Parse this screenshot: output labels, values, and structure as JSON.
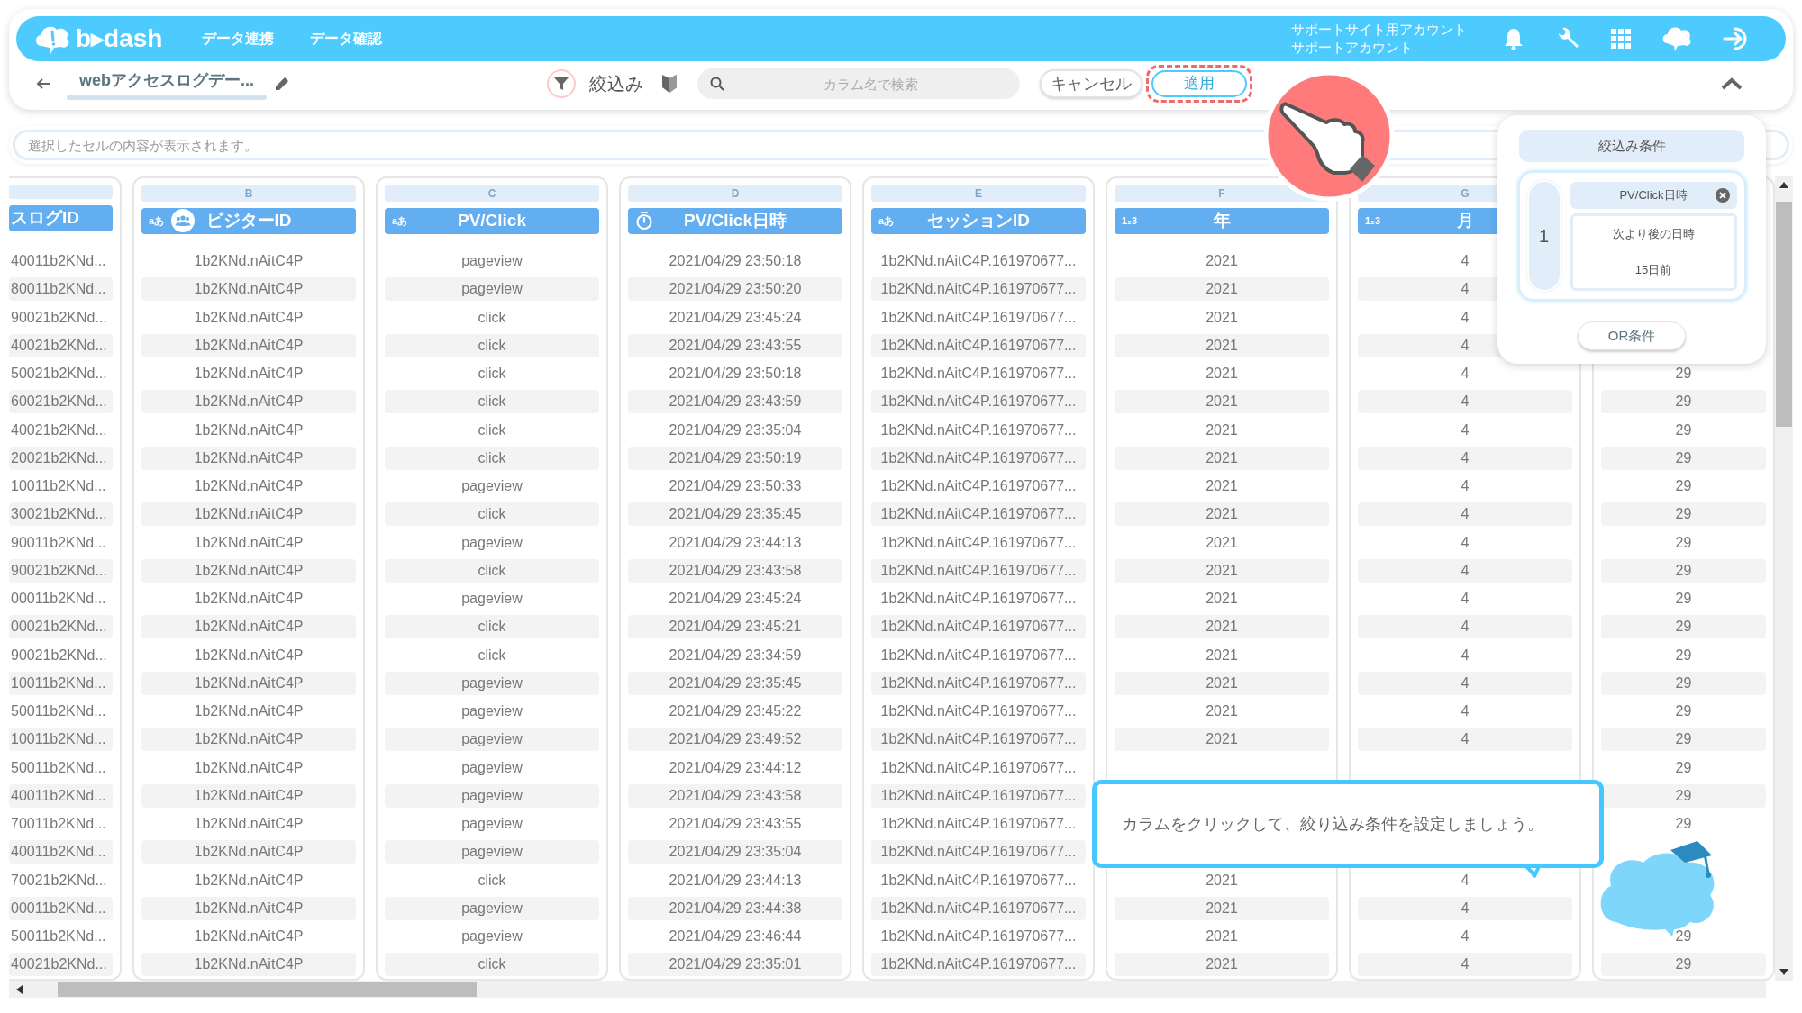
{
  "header": {
    "logo": "b▸dash",
    "nav": [
      "データ連携",
      "データ確認"
    ],
    "account": [
      "サポートサイト用アカウント",
      "サポートアカウント"
    ]
  },
  "toolbar": {
    "title": "webアクセスログデー...",
    "filter_active": true,
    "filter_label": "絞込み",
    "search_placeholder": "カラム名で検索",
    "cancel": "キャンセル",
    "apply": "適用",
    "apply_highlighted": true
  },
  "cell_field": {
    "placeholder": "選択したセルの内容が表示されます。"
  },
  "columns": [
    {
      "title": "スログID"
    },
    {
      "letter": "B",
      "type_label": "aあ",
      "kind": "people",
      "title": "ビジターID"
    },
    {
      "letter": "C",
      "type_label": "aあ",
      "title": "PV/Click"
    },
    {
      "letter": "D",
      "kind": "timer",
      "title": "PV/Click日時"
    },
    {
      "letter": "E",
      "type_label": "aあ",
      "title": "セッションID"
    },
    {
      "letter": "F",
      "type_label": "1₂3",
      "title": "年"
    },
    {
      "letter": "G",
      "type_label": "1₂3",
      "title": "月"
    }
  ],
  "rows": [
    [
      "40011b2KNd...",
      "1b2KNd.nAitC4P",
      "pageview",
      "2021/04/29 23:50:18",
      "1b2KNd.nAitC4P.161970677...",
      "2021",
      "4",
      null
    ],
    [
      "80011b2KNd...",
      "1b2KNd.nAitC4P",
      "pageview",
      "2021/04/29 23:50:20",
      "1b2KNd.nAitC4P.161970677...",
      "2021",
      "4",
      null
    ],
    [
      "90021b2KNd...",
      "1b2KNd.nAitC4P",
      "click",
      "2021/04/29 23:45:24",
      "1b2KNd.nAitC4P.161970677...",
      "2021",
      "4",
      null
    ],
    [
      "40021b2KNd...",
      "1b2KNd.nAitC4P",
      "click",
      "2021/04/29 23:43:55",
      "1b2KNd.nAitC4P.161970677...",
      "2021",
      "4",
      null
    ],
    [
      "50021b2KNd...",
      "1b2KNd.nAitC4P",
      "click",
      "2021/04/29 23:50:18",
      "1b2KNd.nAitC4P.161970677...",
      "2021",
      "4",
      "29"
    ],
    [
      "60021b2KNd...",
      "1b2KNd.nAitC4P",
      "click",
      "2021/04/29 23:43:59",
      "1b2KNd.nAitC4P.161970677...",
      "2021",
      "4",
      "29"
    ],
    [
      "40021b2KNd...",
      "1b2KNd.nAitC4P",
      "click",
      "2021/04/29 23:35:04",
      "1b2KNd.nAitC4P.161970677...",
      "2021",
      "4",
      "29"
    ],
    [
      "20021b2KNd...",
      "1b2KNd.nAitC4P",
      "click",
      "2021/04/29 23:50:19",
      "1b2KNd.nAitC4P.161970677...",
      "2021",
      "4",
      "29"
    ],
    [
      "10011b2KNd...",
      "1b2KNd.nAitC4P",
      "pageview",
      "2021/04/29 23:50:33",
      "1b2KNd.nAitC4P.161970677...",
      "2021",
      "4",
      "29"
    ],
    [
      "30021b2KNd...",
      "1b2KNd.nAitC4P",
      "click",
      "2021/04/29 23:35:45",
      "1b2KNd.nAitC4P.161970677...",
      "2021",
      "4",
      "29"
    ],
    [
      "90011b2KNd...",
      "1b2KNd.nAitC4P",
      "pageview",
      "2021/04/29 23:44:13",
      "1b2KNd.nAitC4P.161970677...",
      "2021",
      "4",
      "29"
    ],
    [
      "90021b2KNd...",
      "1b2KNd.nAitC4P",
      "click",
      "2021/04/29 23:43:58",
      "1b2KNd.nAitC4P.161970677...",
      "2021",
      "4",
      "29"
    ],
    [
      "00011b2KNd...",
      "1b2KNd.nAitC4P",
      "pageview",
      "2021/04/29 23:45:24",
      "1b2KNd.nAitC4P.161970677...",
      "2021",
      "4",
      "29"
    ],
    [
      "00021b2KNd...",
      "1b2KNd.nAitC4P",
      "click",
      "2021/04/29 23:45:21",
      "1b2KNd.nAitC4P.161970677...",
      "2021",
      "4",
      "29"
    ],
    [
      "90021b2KNd...",
      "1b2KNd.nAitC4P",
      "click",
      "2021/04/29 23:34:59",
      "1b2KNd.nAitC4P.161970677...",
      "2021",
      "4",
      "29"
    ],
    [
      "10011b2KNd...",
      "1b2KNd.nAitC4P",
      "pageview",
      "2021/04/29 23:35:45",
      "1b2KNd.nAitC4P.161970677...",
      "2021",
      "4",
      "29"
    ],
    [
      "50011b2KNd...",
      "1b2KNd.nAitC4P",
      "pageview",
      "2021/04/29 23:45:22",
      "1b2KNd.nAitC4P.161970677...",
      "2021",
      "4",
      "29"
    ],
    [
      "10011b2KNd...",
      "1b2KNd.nAitC4P",
      "pageview",
      "2021/04/29 23:49:52",
      "1b2KNd.nAitC4P.161970677...",
      "2021",
      "4",
      "29"
    ],
    [
      "50011b2KNd...",
      "1b2KNd.nAitC4P",
      "pageview",
      "2021/04/29 23:44:12",
      "1b2KNd.nAitC4P.161970677...",
      null,
      null,
      "29"
    ],
    [
      "40011b2KNd...",
      "1b2KNd.nAitC4P",
      "pageview",
      "2021/04/29 23:43:58",
      "1b2KNd.nAitC4P.161970677...",
      null,
      null,
      "29"
    ],
    [
      "70011b2KNd...",
      "1b2KNd.nAitC4P",
      "pageview",
      "2021/04/29 23:43:55",
      "1b2KNd.nAitC4P.161970677...",
      null,
      null,
      "29"
    ],
    [
      "40011b2KNd...",
      "1b2KNd.nAitC4P",
      "pageview",
      "2021/04/29 23:35:04",
      "1b2KNd.nAitC4P.161970677...",
      null,
      null,
      null
    ],
    [
      "70021b2KNd...",
      "1b2KNd.nAitC4P",
      "click",
      "2021/04/29 23:44:13",
      "1b2KNd.nAitC4P.161970677...",
      "2021",
      "4",
      null
    ],
    [
      "00011b2KNd...",
      "1b2KNd.nAitC4P",
      "pageview",
      "2021/04/29 23:44:38",
      "1b2KNd.nAitC4P.161970677...",
      "2021",
      "4",
      null
    ],
    [
      "50011b2KNd...",
      "1b2KNd.nAitC4P",
      "pageview",
      "2021/04/29 23:46:44",
      "1b2KNd.nAitC4P.161970677...",
      "2021",
      "4",
      "29"
    ],
    [
      "40021b2KNd...",
      "1b2KNd.nAitC4P",
      "click",
      "2021/04/29 23:35:01",
      "1b2KNd.nAitC4P.161970677...",
      "2021",
      "4",
      "29"
    ]
  ],
  "filter_panel": {
    "title": "絞込み条件",
    "conditions": [
      {
        "number": "1",
        "column": "PV/Click日時",
        "operator": "次より後の日時",
        "value": "15日前"
      }
    ],
    "or_button": "OR条件"
  },
  "tooltip": {
    "text": "カラムをクリックして、絞り込み条件を設定しましょう。"
  }
}
